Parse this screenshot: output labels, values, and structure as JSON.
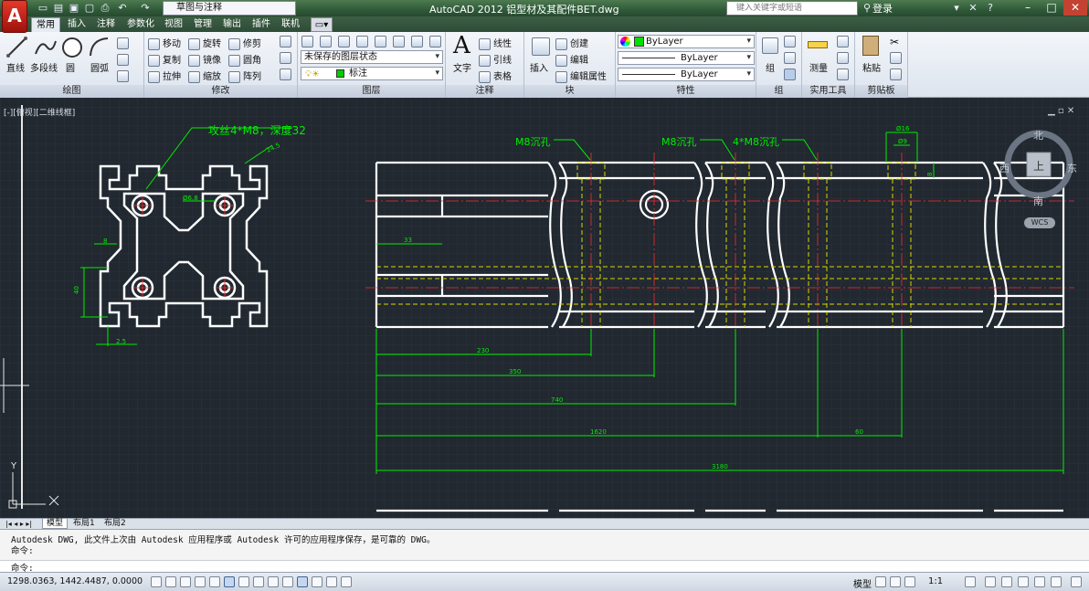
{
  "app": {
    "logo": "A",
    "workspace": "草图与注释",
    "title": "AutoCAD 2012   铝型材及其配件BET.dwg",
    "search_placeholder": "键入关键字或短语",
    "login": "登录"
  },
  "tabs": [
    "常用",
    "插入",
    "注释",
    "参数化",
    "视图",
    "管理",
    "输出",
    "插件",
    "联机"
  ],
  "ribbon": {
    "draw": {
      "title": "绘图",
      "line": "直线",
      "polyline": "多段线",
      "circle": "圆",
      "arc": "圆弧"
    },
    "modify": {
      "title": "修改",
      "move": "移动",
      "rotate": "旋转",
      "trim": "修剪",
      "copy": "复制",
      "mirror": "镜像",
      "fillet": "圆角",
      "stretch": "拉伸",
      "scale": "缩放",
      "array": "阵列"
    },
    "layers": {
      "title": "图层",
      "layer_state": "未保存的图层状态",
      "current_layer": "标注"
    },
    "annotation": {
      "title": "注释",
      "text": "文字",
      "linear": "线性",
      "leader": "引线",
      "table": "表格"
    },
    "block": {
      "title": "块",
      "insert": "插入",
      "create": "创建",
      "edit": "编辑",
      "edit_attr": "编辑属性"
    },
    "properties": {
      "title": "特性",
      "color": "ByLayer",
      "linetype": "ByLayer",
      "lineweight": "ByLayer"
    },
    "groups": {
      "title": "组",
      "group": "组"
    },
    "utilities": {
      "title": "实用工具",
      "measure": "测量"
    },
    "clipboard": {
      "title": "剪贴板",
      "paste": "粘贴"
    }
  },
  "viewport": {
    "label": "[-][俯视][二维线框]",
    "viewcube": {
      "north": "北",
      "south": "南",
      "east": "东",
      "west": "西",
      "top": "上"
    },
    "wcs": "WCS"
  },
  "drawing": {
    "note_tap": "攻丝4*M8，深度32",
    "note_m8_1": "M8沉孔",
    "note_m8_2": "M8沉孔",
    "note_4m8": "4*M8沉孔",
    "dim_diag": "24.5",
    "dim_hole": "Ø6.8",
    "dim_8": "8",
    "dim_40": "40",
    "dim_25": "2.5",
    "dim_33": "33",
    "dim_16": "Ø16",
    "dim_9": "Ø9",
    "dim_8b": "8",
    "dim_230": "230",
    "dim_350": "350",
    "dim_740": "740",
    "dim_1620": "1620",
    "dim_60": "60",
    "dim_3180": "3180"
  },
  "layout_tabs": [
    "模型",
    "布局1",
    "布局2"
  ],
  "command": {
    "history": "Autodesk DWG,   此文件上次由 Autodesk 应用程序或 Autodesk 许可的应用程序保存，是可靠的 DWG。",
    "prompt1": "命令:",
    "prompt2": "命令:"
  },
  "status": {
    "coords": "1298.0363, 1442.4487, 0.0000",
    "model": "模型",
    "scale": "1:1"
  },
  "colors": {
    "canvas": "#212830",
    "dim": "#00ff00",
    "center": "#ff2020",
    "hidden": "#d8d800",
    "geom": "#ffffff"
  }
}
